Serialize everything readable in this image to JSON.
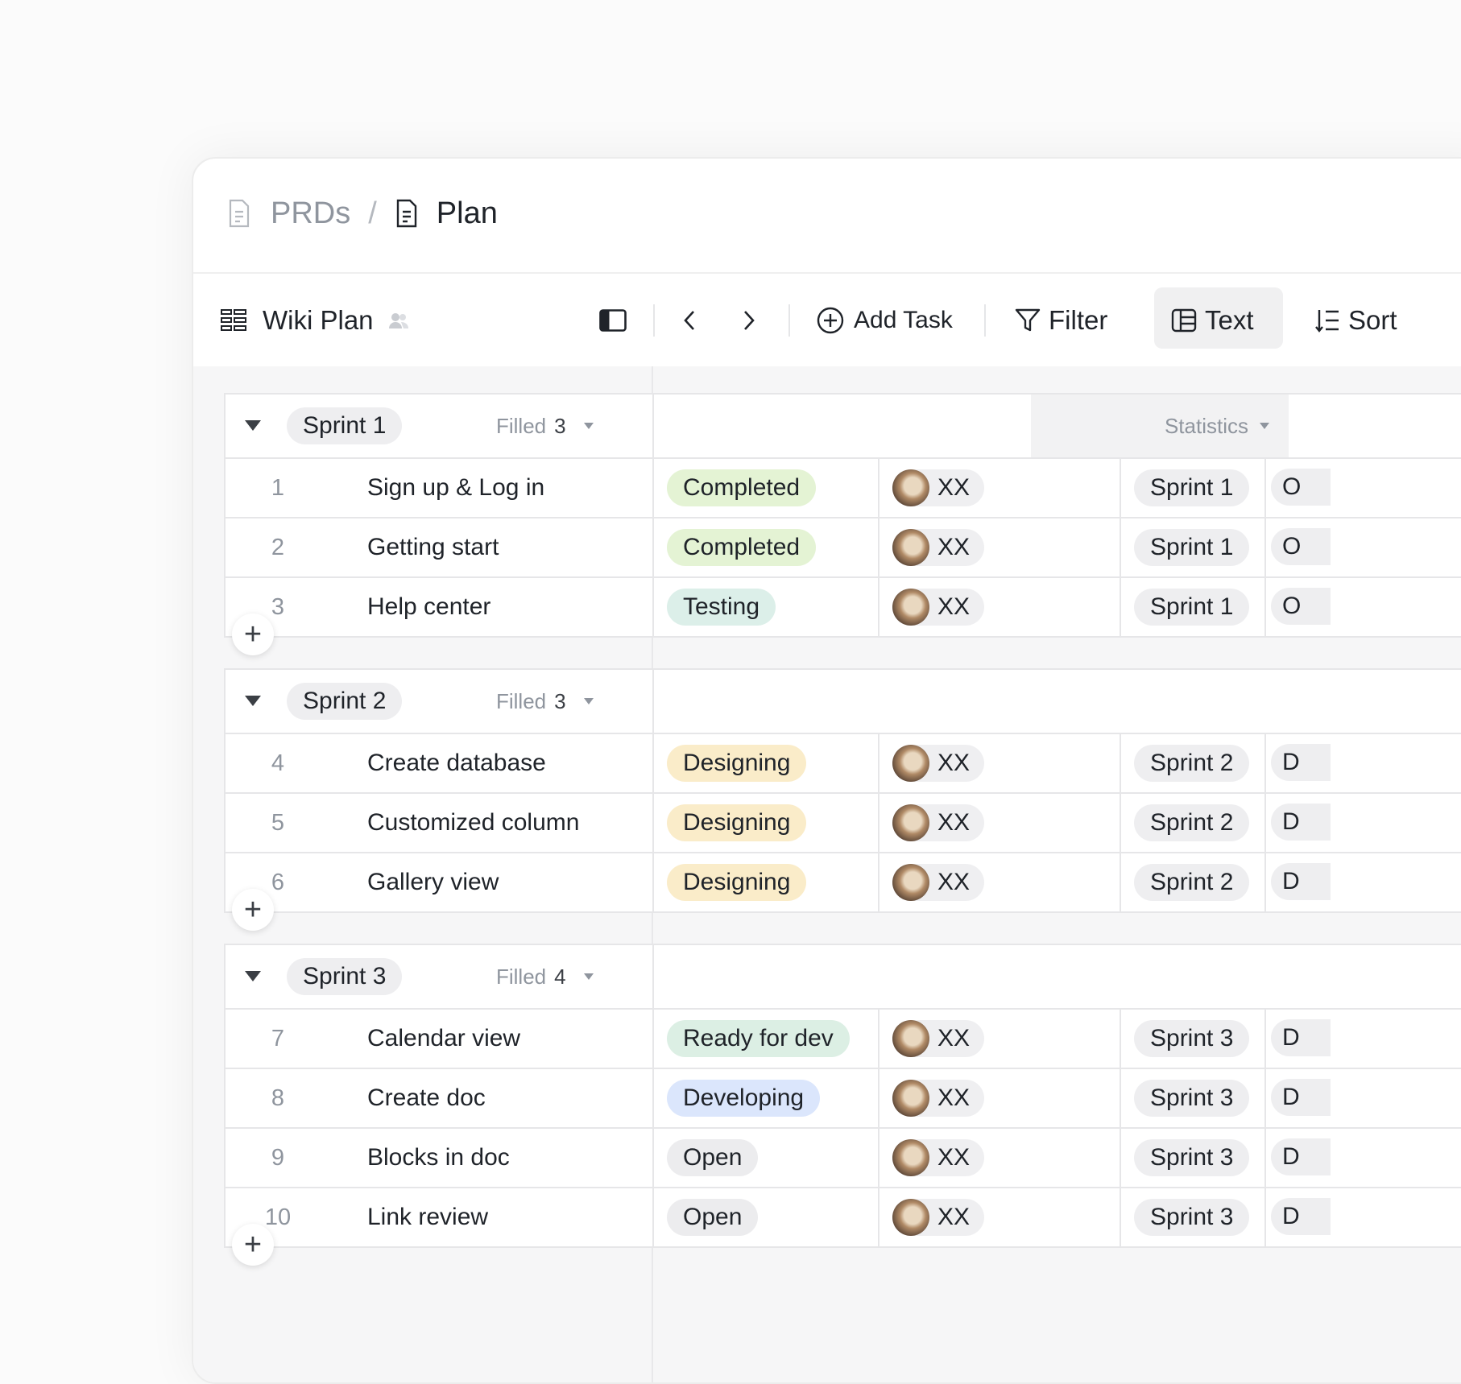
{
  "breadcrumb": {
    "parent": "PRDs",
    "separator": "/",
    "current": "Plan"
  },
  "toolbar": {
    "view_name": "Wiki Plan",
    "add_task": "Add Task",
    "filter": "Filter",
    "text": "Text",
    "sort": "Sort"
  },
  "statistics_label": "Statistics",
  "groups": [
    {
      "name": "Sprint 1",
      "filled_label": "Filled",
      "filled_count": "3",
      "rows": [
        {
          "num": "1",
          "title": "Sign up & Log in",
          "status": "Completed",
          "status_color": "#e4f3d4",
          "assignee": "XX",
          "sprint": "Sprint 1",
          "edge": "O"
        },
        {
          "num": "2",
          "title": "Getting start",
          "status": "Completed",
          "status_color": "#e4f3d4",
          "assignee": "XX",
          "sprint": "Sprint 1",
          "edge": "O"
        },
        {
          "num": "3",
          "title": "Help center",
          "status": "Testing",
          "status_color": "#dcefe9",
          "assignee": "XX",
          "sprint": "Sprint 1",
          "edge": "O"
        }
      ]
    },
    {
      "name": "Sprint 2",
      "filled_label": "Filled",
      "filled_count": "3",
      "rows": [
        {
          "num": "4",
          "title": "Create database",
          "status": "Designing",
          "status_color": "#faecc9",
          "assignee": "XX",
          "sprint": "Sprint 2",
          "edge": "D"
        },
        {
          "num": "5",
          "title": "Customized column",
          "status": "Designing",
          "status_color": "#faecc9",
          "assignee": "XX",
          "sprint": "Sprint 2",
          "edge": "D"
        },
        {
          "num": "6",
          "title": "Gallery view",
          "status": "Designing",
          "status_color": "#faecc9",
          "assignee": "XX",
          "sprint": "Sprint 2",
          "edge": "D"
        }
      ]
    },
    {
      "name": "Sprint 3",
      "filled_label": "Filled",
      "filled_count": "4",
      "rows": [
        {
          "num": "7",
          "title": "Calendar view",
          "status": "Ready for dev",
          "status_color": "#dcefe4",
          "assignee": "XX",
          "sprint": "Sprint 3",
          "edge": "D"
        },
        {
          "num": "8",
          "title": "Create doc",
          "status": "Developing",
          "status_color": "#dbe6fc",
          "assignee": "XX",
          "sprint": "Sprint 3",
          "edge": "D"
        },
        {
          "num": "9",
          "title": "Blocks in doc",
          "status": "Open",
          "status_color": "#ececee",
          "assignee": "XX",
          "sprint": "Sprint 3",
          "edge": "D"
        },
        {
          "num": "10",
          "title": "Link review",
          "status": "Open",
          "status_color": "#ececee",
          "assignee": "XX",
          "sprint": "Sprint 3",
          "edge": "D"
        }
      ]
    }
  ]
}
